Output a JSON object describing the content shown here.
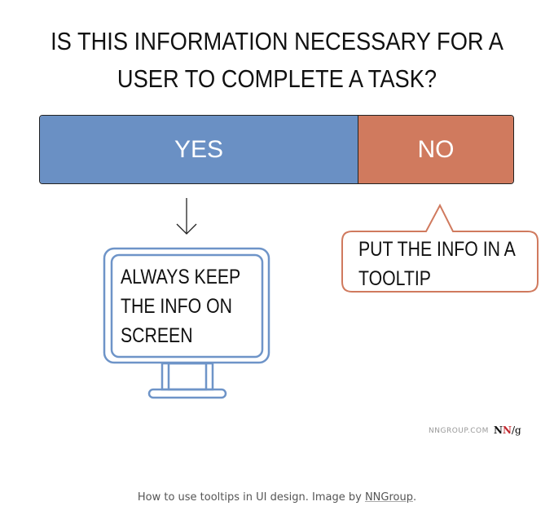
{
  "title": "IS THIS INFORMATION NECESSARY FOR A USER TO COMPLETE A TASK?",
  "options": {
    "yes": "YES",
    "no": "NO"
  },
  "yes_result": "ALWAYS KEEP THE INFO ON SCREEN",
  "no_result": "PUT THE INFO IN A TOOLTIP",
  "colors": {
    "yes": "#6a90c4",
    "no": "#d07a5e"
  },
  "icons": {
    "arrow": "arrow-down-icon",
    "monitor": "monitor-icon",
    "bubble": "speech-bubble"
  },
  "footer": {
    "source": "NNGROUP.COM",
    "logo": "NN/g"
  },
  "caption": {
    "text": "How to use tooltips in UI design. Image by ",
    "link": "NNGroup",
    "end": "."
  }
}
